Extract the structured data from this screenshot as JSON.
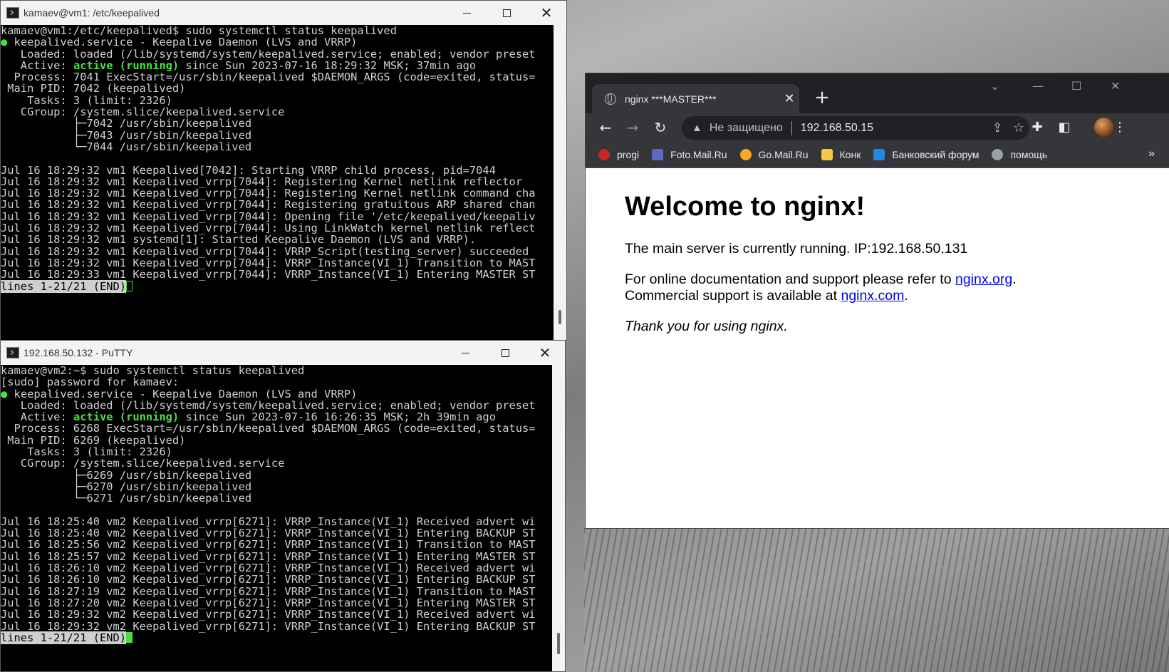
{
  "colors": {
    "terminal_bg": "#000000",
    "terminal_text": "#cfcfcf",
    "terminal_highlight": "#46e33e",
    "browser_chrome": "#35363a",
    "link": "#0000ee"
  },
  "terminal1": {
    "title": "kamaev@vm1: /etc/keepalived",
    "icon": "terminal-icon",
    "lines": [
      "kamaev@vm1:/etc/keepalived$ sudo systemctl status keepalived",
      "● keepalived.service - Keepalive Daemon (LVS and VRRP)",
      "   Loaded: loaded (/lib/systemd/system/keepalived.service; enabled; vendor preset",
      "   Active: active (running) since Sun 2023-07-16 18:29:32 MSK; 37min ago",
      "  Process: 7041 ExecStart=/usr/sbin/keepalived $DAEMON_ARGS (code=exited, status=",
      " Main PID: 7042 (keepalived)",
      "    Tasks: 3 (limit: 2326)",
      "   CGroup: /system.slice/keepalived.service",
      "           ├─7042 /usr/sbin/keepalived",
      "           ├─7043 /usr/sbin/keepalived",
      "           └─7044 /usr/sbin/keepalived",
      "",
      "Jul 16 18:29:32 vm1 Keepalived[7042]: Starting VRRP child process, pid=7044",
      "Jul 16 18:29:32 vm1 Keepalived_vrrp[7044]: Registering Kernel netlink reflector",
      "Jul 16 18:29:32 vm1 Keepalived_vrrp[7044]: Registering Kernel netlink command cha",
      "Jul 16 18:29:32 vm1 Keepalived_vrrp[7044]: Registering gratuitous ARP shared chan",
      "Jul 16 18:29:32 vm1 Keepalived_vrrp[7044]: Opening file '/etc/keepalived/keepaliv",
      "Jul 16 18:29:32 vm1 Keepalived_vrrp[7044]: Using LinkWatch kernel netlink reflect",
      "Jul 16 18:29:32 vm1 systemd[1]: Started Keepalive Daemon (LVS and VRRP).",
      "Jul 16 18:29:32 vm1 Keepalived_vrrp[7044]: VRRP_Script(testing_server) succeeded",
      "Jul 16 18:29:32 vm1 Keepalived_vrrp[7044]: VRRP_Instance(VI_1) Transition to MAST",
      "Jul 16 18:29:33 vm1 Keepalived_vrrp[7044]: VRRP_Instance(VI_1) Entering MASTER ST"
    ],
    "dot": "●",
    "status_prefix": "   Active: ",
    "status_word": "active (running)",
    "status_suffix": " since Sun 2023-07-16 18:29:32 MSK; 37min ago",
    "pager_status": "lines 1-21/21 (END)"
  },
  "terminal2": {
    "title": "192.168.50.132 - PuTTY",
    "icon": "putty-icon",
    "lines": [
      "kamaev@vm2:~$ sudo systemctl status keepalived",
      "[sudo] password for kamaev:",
      "● keepalived.service - Keepalive Daemon (LVS and VRRP)",
      "   Loaded: loaded (/lib/systemd/system/keepalived.service; enabled; vendor preset",
      "   Active: active (running) since Sun 2023-07-16 16:26:35 MSK; 2h 39min ago",
      "  Process: 6268 ExecStart=/usr/sbin/keepalived $DAEMON_ARGS (code=exited, status=",
      " Main PID: 6269 (keepalived)",
      "    Tasks: 3 (limit: 2326)",
      "   CGroup: /system.slice/keepalived.service",
      "           ├─6269 /usr/sbin/keepalived",
      "           ├─6270 /usr/sbin/keepalived",
      "           └─6271 /usr/sbin/keepalived",
      "",
      "Jul 16 18:25:40 vm2 Keepalived_vrrp[6271]: VRRP_Instance(VI_1) Received advert wi",
      "Jul 16 18:25:40 vm2 Keepalived_vrrp[6271]: VRRP_Instance(VI_1) Entering BACKUP ST",
      "Jul 16 18:25:56 vm2 Keepalived_vrrp[6271]: VRRP_Instance(VI_1) Transition to MAST",
      "Jul 16 18:25:57 vm2 Keepalived_vrrp[6271]: VRRP_Instance(VI_1) Entering MASTER ST",
      "Jul 16 18:26:10 vm2 Keepalived_vrrp[6271]: VRRP_Instance(VI_1) Received advert wi",
      "Jul 16 18:26:10 vm2 Keepalived_vrrp[6271]: VRRP_Instance(VI_1) Entering BACKUP ST",
      "Jul 16 18:27:19 vm2 Keepalived_vrrp[6271]: VRRP_Instance(VI_1) Transition to MAST",
      "Jul 16 18:27:20 vm2 Keepalived_vrrp[6271]: VRRP_Instance(VI_1) Entering MASTER ST",
      "Jul 16 18:29:32 vm2 Keepalived_vrrp[6271]: VRRP_Instance(VI_1) Received advert wi",
      "Jul 16 18:29:32 vm2 Keepalived_vrrp[6271]: VRRP_Instance(VI_1) Entering BACKUP ST"
    ],
    "dot": "●",
    "status_prefix": "   Active: ",
    "status_word": "active (running)",
    "status_suffix": " since Sun 2023-07-16 16:26:35 MSK; 2h 39min ago",
    "pager_status": "lines 1-21/21 (END)"
  },
  "browser": {
    "tab_title": "nginx ***MASTER***",
    "tab_close": "✕",
    "new_tab": "+",
    "not_secure": "Не защищено",
    "url": "192.168.50.15",
    "bookmarks": [
      {
        "label": "progi",
        "icon": "umbrella-icon",
        "color": "#c62828"
      },
      {
        "label": "Foto.Mail.Ru",
        "icon": "camera-icon",
        "color": "#5c6bc0"
      },
      {
        "label": "Go.Mail.Ru",
        "icon": "search-icon",
        "color": "#f9a825"
      },
      {
        "label": "Конк",
        "icon": "folder-icon",
        "color": "#f6c945"
      },
      {
        "label": "Банковский форум",
        "icon": "forum-icon",
        "color": "#1e88e5"
      },
      {
        "label": "помощь",
        "icon": "globe-icon",
        "color": "#9aa0a6"
      }
    ],
    "bookmarks_more": "»",
    "page": {
      "heading": "Welcome to nginx!",
      "running_text": "The main server is currently running. IP:192.168.50.131",
      "doc_prefix": "For online documentation and support please refer to ",
      "doc_link": "nginx.org",
      "doc_suffix": ".",
      "commercial_prefix": "Commercial support is available at ",
      "commercial_link": "nginx.com",
      "commercial_suffix": ".",
      "thanks": "Thank you for using nginx."
    }
  }
}
